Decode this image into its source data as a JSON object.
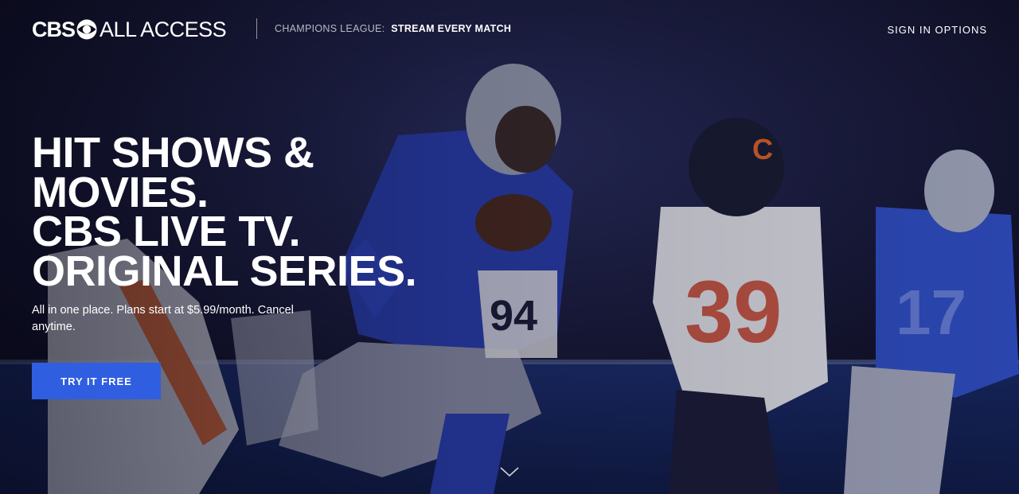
{
  "brand": {
    "wordmark_left": "CBS",
    "wordmark_right": "ALL ACCESS",
    "logo_icon": "cbs-eye-icon"
  },
  "header": {
    "promo_label": "CHAMPIONS LEAGUE:",
    "promo_cta": "STREAM EVERY MATCH",
    "signin_label": "SIGN IN OPTIONS"
  },
  "hero": {
    "headline_lines": [
      "HIT SHOWS &",
      "MOVIES.",
      "CBS LIVE TV.",
      "ORIGINAL SERIES."
    ],
    "subcopy": "All in one place. Plans start at $5.99/month. Cancel anytime.",
    "cta_label": "TRY IT FREE",
    "scroll_icon": "chevron-down-icon",
    "background": "football-game-photo"
  },
  "colors": {
    "cta_blue": "#2f5fe0",
    "text_white": "#ffffff",
    "promo_grey": "#b7b9c7"
  }
}
